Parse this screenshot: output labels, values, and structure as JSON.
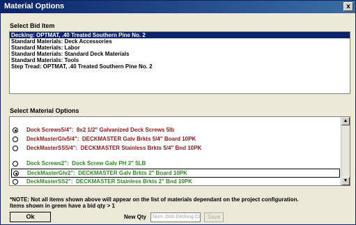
{
  "window": {
    "title": "Material Options",
    "close_glyph": "x"
  },
  "bid_section": {
    "label": "Select Bid Item",
    "items": [
      {
        "text": "Decking:  OPTMAT, .40 Treated Southern Pine No. 2",
        "selected": true
      },
      {
        "text": "Standard Materials:  Deck Accessories"
      },
      {
        "text": "Standard Materials:  Labor"
      },
      {
        "text": "Standard Materials:  Standard Deck Materials"
      },
      {
        "text": "Standard Materials:  Tools"
      },
      {
        "text": "Step Tread:  OPTMAT, .40 Treated Southern Pine No. 2"
      }
    ]
  },
  "material_section": {
    "label": "Select Material Options",
    "rows": [
      {
        "key": "Dock Screws5/4\":",
        "desc": "8x2 1/2\" Galvanized Deck Screws 5lb",
        "color": "red",
        "checked": true
      },
      {
        "key": "DeckMasterGlv5/4\":",
        "desc": "DECKMASTER Galv Brkts 5/4\" Board 10PK",
        "color": "red",
        "checked": false
      },
      {
        "key": "DeckMasterSS5/4\":",
        "desc": "DECKMASTER Stainless Brkts 5/4\" Bnd 10PK",
        "color": "red",
        "checked": false
      },
      {
        "key": "Dock Screws2\":",
        "desc": "Dock Screw Galv PH 3\" 5LB",
        "color": "green",
        "checked": false
      },
      {
        "key": "DeckMasterGlv2\":",
        "desc": "DECKMASTER Galv Brkts 2\" Board 10PK",
        "color": "green",
        "checked": true,
        "focused": true
      },
      {
        "key": "DeckMasterSS2\":",
        "desc": "DECKMASTER Stainless Brkts 2\" Bnd 10PK",
        "color": "green",
        "checked": false
      }
    ],
    "colors": {
      "red": "#8b1a1a",
      "green": "#2e8b22"
    }
  },
  "note": {
    "line1": "*NOTE:  Not all items shown above will appear on the list of materials dependant on the project configuration.",
    "line2": "Items shown in green have a bid qty > 1"
  },
  "footer": {
    "ok_label": "Ok",
    "new_qty_label": "New Qty",
    "new_qty_placeholder": "Num Joist-Decking Conn Ze",
    "save_label": "Save"
  },
  "icons": {
    "scroll_up": "up-arrow-icon",
    "scroll_down": "down-arrow-icon"
  }
}
